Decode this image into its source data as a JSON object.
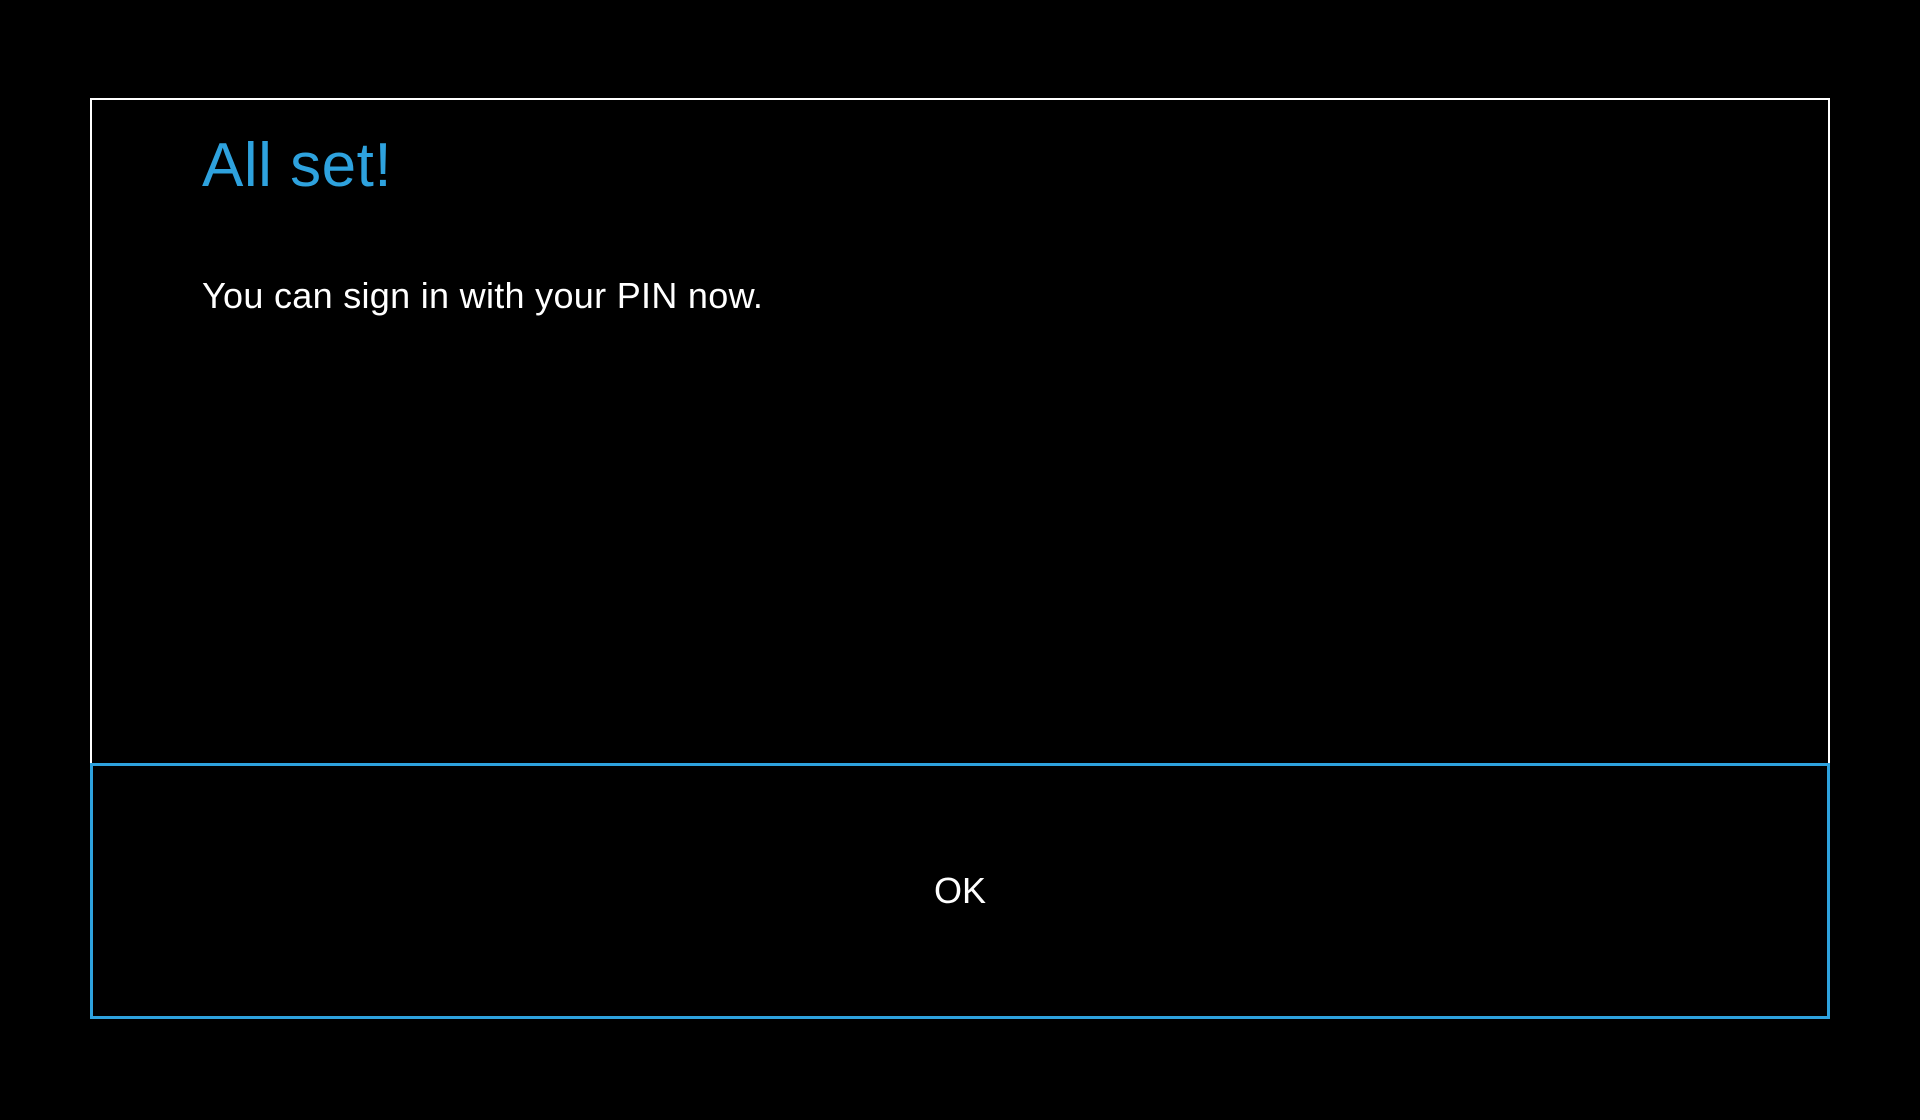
{
  "dialog": {
    "title": "All set!",
    "message": "You can sign in with your PIN now.",
    "ok_label": "OK"
  },
  "colors": {
    "accent": "#2ea2de",
    "background": "#000000",
    "text": "#ffffff",
    "border": "#ffffff"
  }
}
